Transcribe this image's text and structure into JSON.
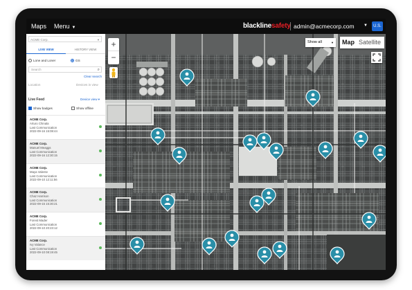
{
  "topbar": {
    "maps_label": "Maps",
    "menu_label": "Menu",
    "brand_part1": "blackline",
    "brand_part2": "safety",
    "user_email": "admin@acmecorp.com",
    "region_badge": "U.S."
  },
  "sidebar": {
    "org_select": "ACME Corp.",
    "tabs": [
      {
        "label": "LIVE VIEW"
      },
      {
        "label": "HISTORY VIEW"
      }
    ],
    "radio_options": [
      {
        "label": "Lone and Loner"
      },
      {
        "label": "GS"
      }
    ],
    "search_placeholder": "Search",
    "clear_search": "Clear search",
    "location_label": "Location",
    "devices_label": "Devices in view",
    "live_feed_label": "Live Feed",
    "device_view_link": "Device view ▾",
    "show_badges_label": "Show badges",
    "show_offline_label": "Show offline",
    "items": [
      {
        "org": "ACME Corp.",
        "name": "Arturo Chinala",
        "status": "Last Communication",
        "time": "2022-09-16 15:08:44"
      },
      {
        "org": "ACME Corp.",
        "name": "Manuel Meaggs",
        "status": "Last Communication",
        "time": "2022-09-16 12:30:15"
      },
      {
        "org": "ACME Corp.",
        "name": "Maya Valente",
        "status": "Last Communication",
        "time": "2022-09-10 12:11:56"
      },
      {
        "org": "ACME Corp.",
        "name": "Chaz Harrison",
        "status": "Last Communication",
        "time": "2022-09-15 15:30:21"
      },
      {
        "org": "ACME Corp.",
        "name": "Forest Mader",
        "status": "Last Communication",
        "time": "2022-09-10 20:23:12"
      },
      {
        "org": "ACME Corp.",
        "name": "Ivy Valance",
        "status": "Last Communication",
        "time": "2022-09-10 08:19:45"
      }
    ]
  },
  "map": {
    "filter_label": "Show all",
    "map_button": "Map",
    "satellite_button": "Satellite",
    "pin_color": "#2a8fa8",
    "pins": [
      {
        "label": "worker-1"
      },
      {
        "label": "worker-2"
      },
      {
        "label": "worker-3"
      },
      {
        "label": "worker-4"
      },
      {
        "label": "worker-5"
      },
      {
        "label": "worker-6"
      },
      {
        "label": "worker-7"
      },
      {
        "label": "worker-8"
      },
      {
        "label": "worker-9"
      },
      {
        "label": "worker-10"
      },
      {
        "label": "worker-11"
      },
      {
        "label": "worker-12"
      },
      {
        "label": "worker-13"
      },
      {
        "label": "worker-14"
      },
      {
        "label": "worker-15"
      },
      {
        "label": "worker-16"
      },
      {
        "label": "worker-17"
      },
      {
        "label": "worker-18"
      },
      {
        "label": "worker-19"
      },
      {
        "label": "worker-20"
      }
    ]
  }
}
